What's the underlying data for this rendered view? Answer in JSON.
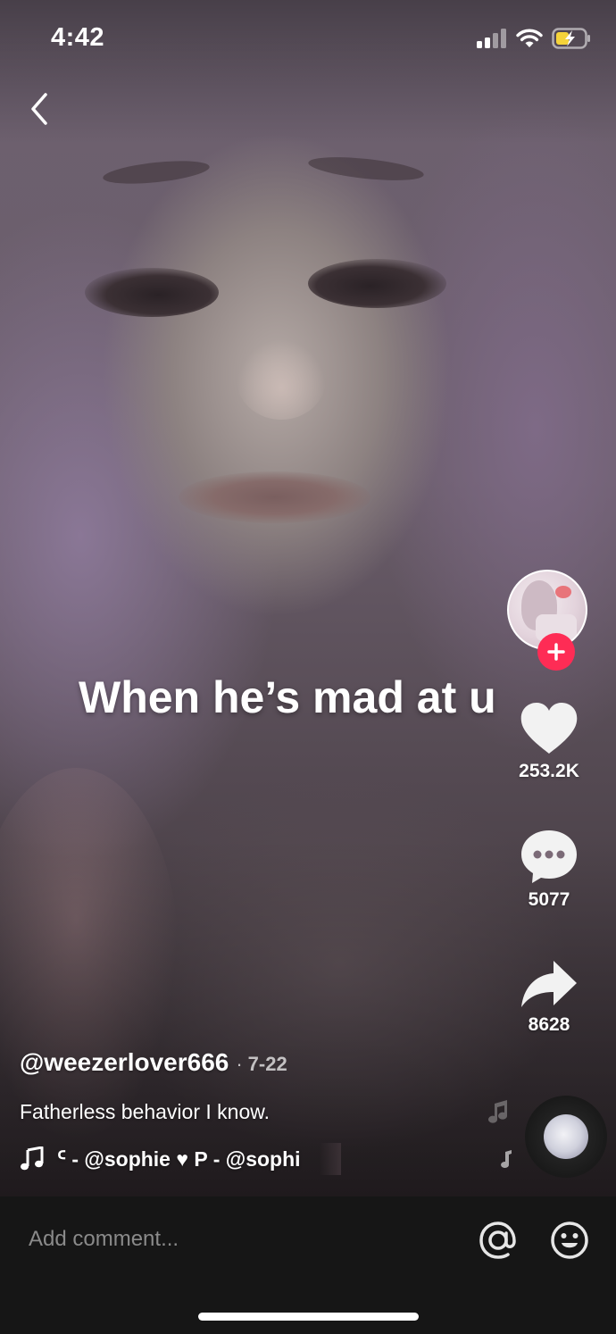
{
  "status_bar": {
    "time": "4:42"
  },
  "overlay": {
    "caption": "When he’s mad at u"
  },
  "actions": {
    "likes": "253.2K",
    "comments": "5077",
    "shares": "8628"
  },
  "post": {
    "username": "@weezerlover666",
    "separator": "·",
    "date": "7-22",
    "description": "Fatherless behavior I know.",
    "music": "ᑦ - @sophie ♥    P - @sophi"
  },
  "comment_bar": {
    "placeholder": "Add comment..."
  },
  "icons": {
    "back": "chevron-left-icon",
    "like": "heart-icon",
    "comment": "speech-bubble-icon",
    "share": "share-arrow-icon",
    "music": "music-note-icon",
    "mention": "at-sign-icon",
    "emoji": "smiley-icon"
  },
  "colors": {
    "follow_accent": "#fe2c55",
    "comment_bar_bg": "#161616",
    "placeholder": "#8a8a8a"
  }
}
